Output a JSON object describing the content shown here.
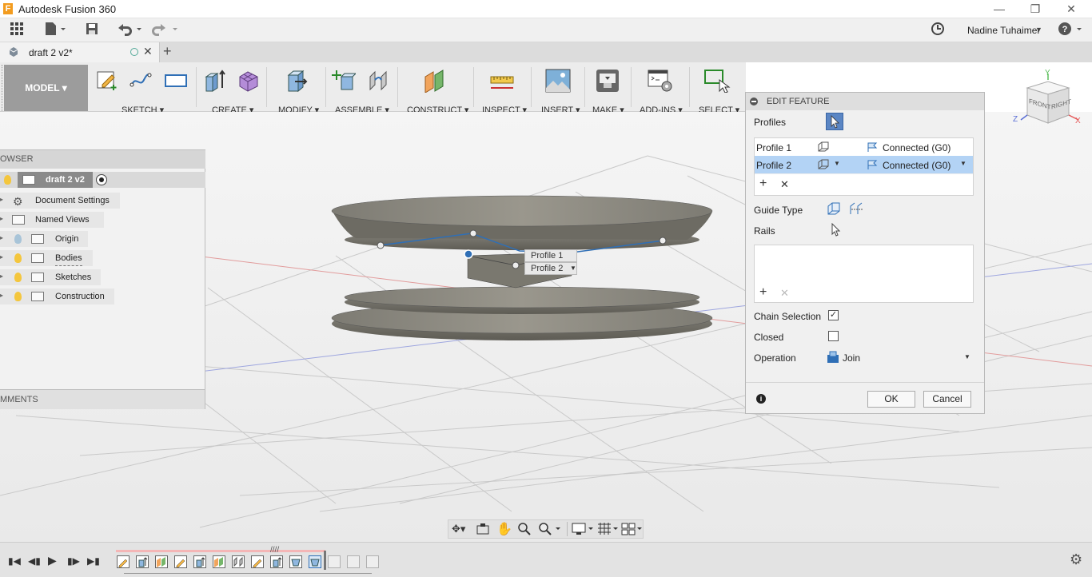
{
  "app": {
    "title": "Autodesk Fusion 360",
    "logo_letter": "F"
  },
  "user": {
    "name": "Nadine Tuhaimer"
  },
  "doc_tab": {
    "label": "draft 2 v2*"
  },
  "ribbon": {
    "workspace": "MODEL",
    "groups": [
      "SKETCH",
      "CREATE",
      "MODIFY",
      "ASSEMBLE",
      "CONSTRUCT",
      "INSPECT",
      "INSERT",
      "MAKE",
      "ADD-INS",
      "SELECT"
    ]
  },
  "browser": {
    "header": "OWSER",
    "root": "draft 2 v2",
    "items": [
      "Document Settings",
      "Named Views",
      "Origin",
      "Bodies",
      "Sketches",
      "Construction"
    ],
    "comments": "MMENTS"
  },
  "canvas_labels": {
    "profile1": "Profile 1",
    "profile2": "Profile 2"
  },
  "edit_feature": {
    "title": "EDIT FEATURE",
    "profiles_label": "Profiles",
    "rows": [
      {
        "name": "Profile 1",
        "continuity": "Connected (G0)"
      },
      {
        "name": "Profile 2",
        "continuity": "Connected (G0)"
      }
    ],
    "guide_type_label": "Guide Type",
    "rails_label": "Rails",
    "chain_selection_label": "Chain Selection",
    "chain_selection_checked": true,
    "closed_label": "Closed",
    "closed_checked": false,
    "operation_label": "Operation",
    "operation_value": "Join",
    "ok_label": "OK",
    "cancel_label": "Cancel"
  },
  "viewcube": {
    "front": "FRONT",
    "right": "RIGHT",
    "axis_x": "X",
    "axis_y": "Y",
    "axis_z": "Z"
  },
  "colors": {
    "selected_row": "#b3d3f5",
    "model_button": "#9c9c9c",
    "accent_blue": "#2f6fb6"
  }
}
